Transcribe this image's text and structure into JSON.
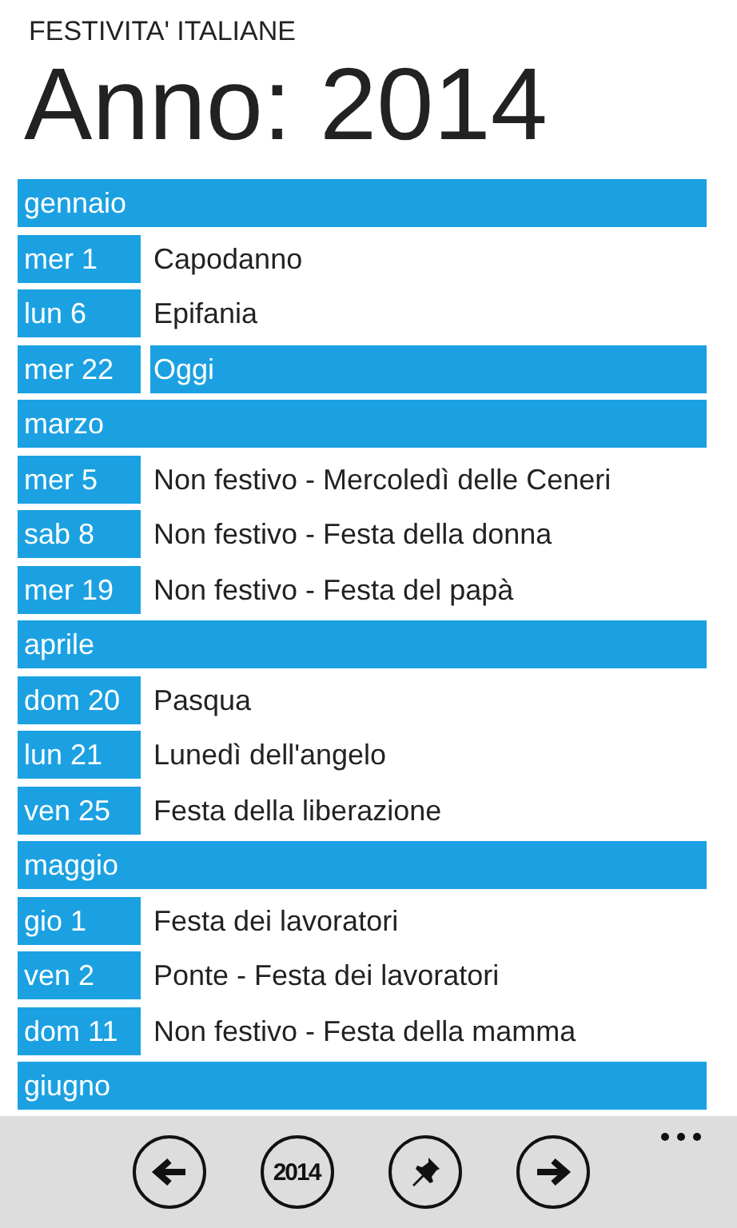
{
  "app_title": "FESTIVITA' ITALIANE",
  "page_title": "Anno: 2014",
  "months": [
    {
      "name": "gennaio",
      "days": [
        {
          "date": "mer 1",
          "label": "Capodanno",
          "today": false
        },
        {
          "date": "lun 6",
          "label": "Epifania",
          "today": false
        },
        {
          "date": "mer 22",
          "label": "Oggi",
          "today": true
        }
      ]
    },
    {
      "name": "marzo",
      "days": [
        {
          "date": "mer 5",
          "label": "Non festivo - Mercoledì delle Ceneri",
          "today": false
        },
        {
          "date": "sab 8",
          "label": "Non festivo - Festa della donna",
          "today": false
        },
        {
          "date": "mer 19",
          "label": "Non festivo - Festa del papà",
          "today": false
        }
      ]
    },
    {
      "name": "aprile",
      "days": [
        {
          "date": "dom 20",
          "label": "Pasqua",
          "today": false
        },
        {
          "date": "lun 21",
          "label": "Lunedì dell'angelo",
          "today": false
        },
        {
          "date": "ven 25",
          "label": "Festa della liberazione",
          "today": false
        }
      ]
    },
    {
      "name": "maggio",
      "days": [
        {
          "date": "gio 1",
          "label": "Festa dei lavoratori",
          "today": false
        },
        {
          "date": "ven 2",
          "label": "Ponte - Festa dei lavoratori",
          "today": false
        },
        {
          "date": "dom 11",
          "label": "Non festivo - Festa della mamma",
          "today": false
        }
      ]
    },
    {
      "name": "giugno"
    }
  ],
  "app_bar": {
    "buttons": [
      {
        "kind": "back"
      },
      {
        "kind": "year",
        "label": "2014"
      },
      {
        "kind": "pin"
      },
      {
        "kind": "forward"
      }
    ]
  }
}
